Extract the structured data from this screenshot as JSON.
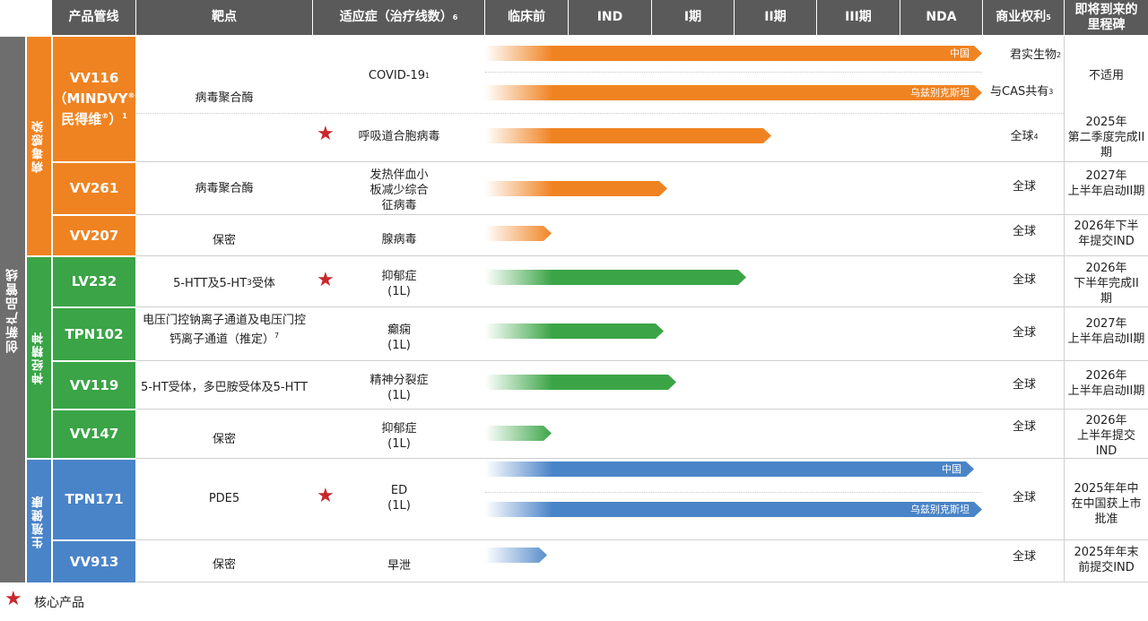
{
  "colors": {
    "orange": "#f08321",
    "green": "#3aa446",
    "blue": "#4a84c8",
    "header": "#5a5a5a",
    "sidebar": "#6e6e6e",
    "star": "#c8282d"
  },
  "headers": {
    "pipeline": "产品管线",
    "target": "靶点",
    "indication": "适应症（治疗线数）",
    "indication_note": "6",
    "preclinical": "临床前",
    "ind": "IND",
    "phase1": "I期",
    "phase2": "II期",
    "phase3": "III期",
    "nda": "NDA",
    "rights": "商业权利",
    "rights_note": "5",
    "milestone": "即将到来的里程碑"
  },
  "outer_label": "创新产品管线",
  "groups": [
    {
      "name": "病毒感染"
    },
    {
      "name": "神经精神"
    },
    {
      "name": "生殖健康"
    }
  ],
  "products": [
    {
      "name": "VV116",
      "sub1": "（MINDVY",
      "sub2": "民得维",
      "note": "1",
      "target": "病毒聚合酶"
    },
    {
      "name": "VV261",
      "target": "病毒聚合酶"
    },
    {
      "name": "VV207",
      "target": "保密"
    },
    {
      "name": "LV232",
      "target": "5-HTT及5-HT",
      "target_sub": "3",
      "target_tail": "受体"
    },
    {
      "name": "TPN102",
      "target1": "电压门控钠离子通道及电压门控",
      "target2": "钙离子通道（推定）",
      "target_note": "7"
    },
    {
      "name": "VV119",
      "target": "5-HT受体，多巴胺受体及5-HTT"
    },
    {
      "name": "VV147",
      "target": "保密"
    },
    {
      "name": "TPN171",
      "target": "PDE5"
    },
    {
      "name": "VV913",
      "target": "保密"
    }
  ],
  "indications": {
    "covid": "COVID-19",
    "covid_note": "1",
    "rsv": "呼吸道合胞病毒",
    "sfts1": "发热伴血小",
    "sfts2": "板减少综合",
    "sfts3": "征病毒",
    "adeno": "腺病毒",
    "dep1": "抑郁症",
    "dep1_line": "(1L)",
    "epi": "癫痫",
    "epi_line": "(1L)",
    "schizo": "精神分裂症",
    "schizo_line": "(1L)",
    "dep2": "抑郁症",
    "dep2_line": "(1L)",
    "ed": "ED",
    "ed_line": "(1L)",
    "pe": "早泄"
  },
  "bars": [
    {
      "id": "vv116-cn",
      "color": "orange",
      "stage_end": 6.0,
      "label": "中国"
    },
    {
      "id": "vv116-uz",
      "color": "orange",
      "stage_end": 6.0,
      "label": "乌兹别克斯坦"
    },
    {
      "id": "vv116-rsv",
      "color": "orange",
      "stage_end": 3.45,
      "label": ""
    },
    {
      "id": "vv261",
      "color": "orange",
      "stage_end": 2.2,
      "label": ""
    },
    {
      "id": "vv207",
      "color": "orange",
      "stage_end": 0.8,
      "label": ""
    },
    {
      "id": "lv232",
      "color": "green",
      "stage_end": 3.15,
      "label": ""
    },
    {
      "id": "tpn102",
      "color": "green",
      "stage_end": 2.15,
      "label": ""
    },
    {
      "id": "vv119",
      "color": "green",
      "stage_end": 2.3,
      "label": ""
    },
    {
      "id": "vv147",
      "color": "green",
      "stage_end": 0.8,
      "label": ""
    },
    {
      "id": "tpn171-cn",
      "color": "blue",
      "stage_end": 5.9,
      "label": "中国"
    },
    {
      "id": "tpn171-uz",
      "color": "blue",
      "stage_end": 6.0,
      "label": "乌兹别克斯坦"
    },
    {
      "id": "vv913",
      "color": "blue",
      "stage_end": 0.75,
      "label": ""
    }
  ],
  "rights": {
    "junshi": "君实生物",
    "junshi_note": "2",
    "cas": "与CAS共有",
    "cas_note": "3",
    "global_rsv": "全球",
    "global_rsv_note": "4",
    "vv261": "全球",
    "vv207": "全球",
    "lv232": "全球",
    "tpn102": "全球",
    "vv119": "全球",
    "vv147": "全球",
    "tpn171": "全球",
    "vv913": "全球"
  },
  "milestones": {
    "covid": "不适用",
    "rsv": [
      "2025年",
      "第二季度完成II",
      "期"
    ],
    "vv261": [
      "2027年",
      "上半年启动II期"
    ],
    "vv207": [
      "2026年下半",
      "年提交IND"
    ],
    "lv232": [
      "2026年",
      "下半年完成II",
      "期"
    ],
    "tpn102": [
      "2027年",
      "上半年启动II期"
    ],
    "vv119": [
      "2026年",
      "上半年启动II期"
    ],
    "vv147": [
      "2026年",
      "上半年提交",
      "IND"
    ],
    "tpn171": [
      "2025年年中",
      "在中国获上市",
      "批准"
    ],
    "vv913": [
      "2025年年末",
      "前提交IND"
    ]
  },
  "legend": {
    "star": "★",
    "label": "核心产品"
  }
}
